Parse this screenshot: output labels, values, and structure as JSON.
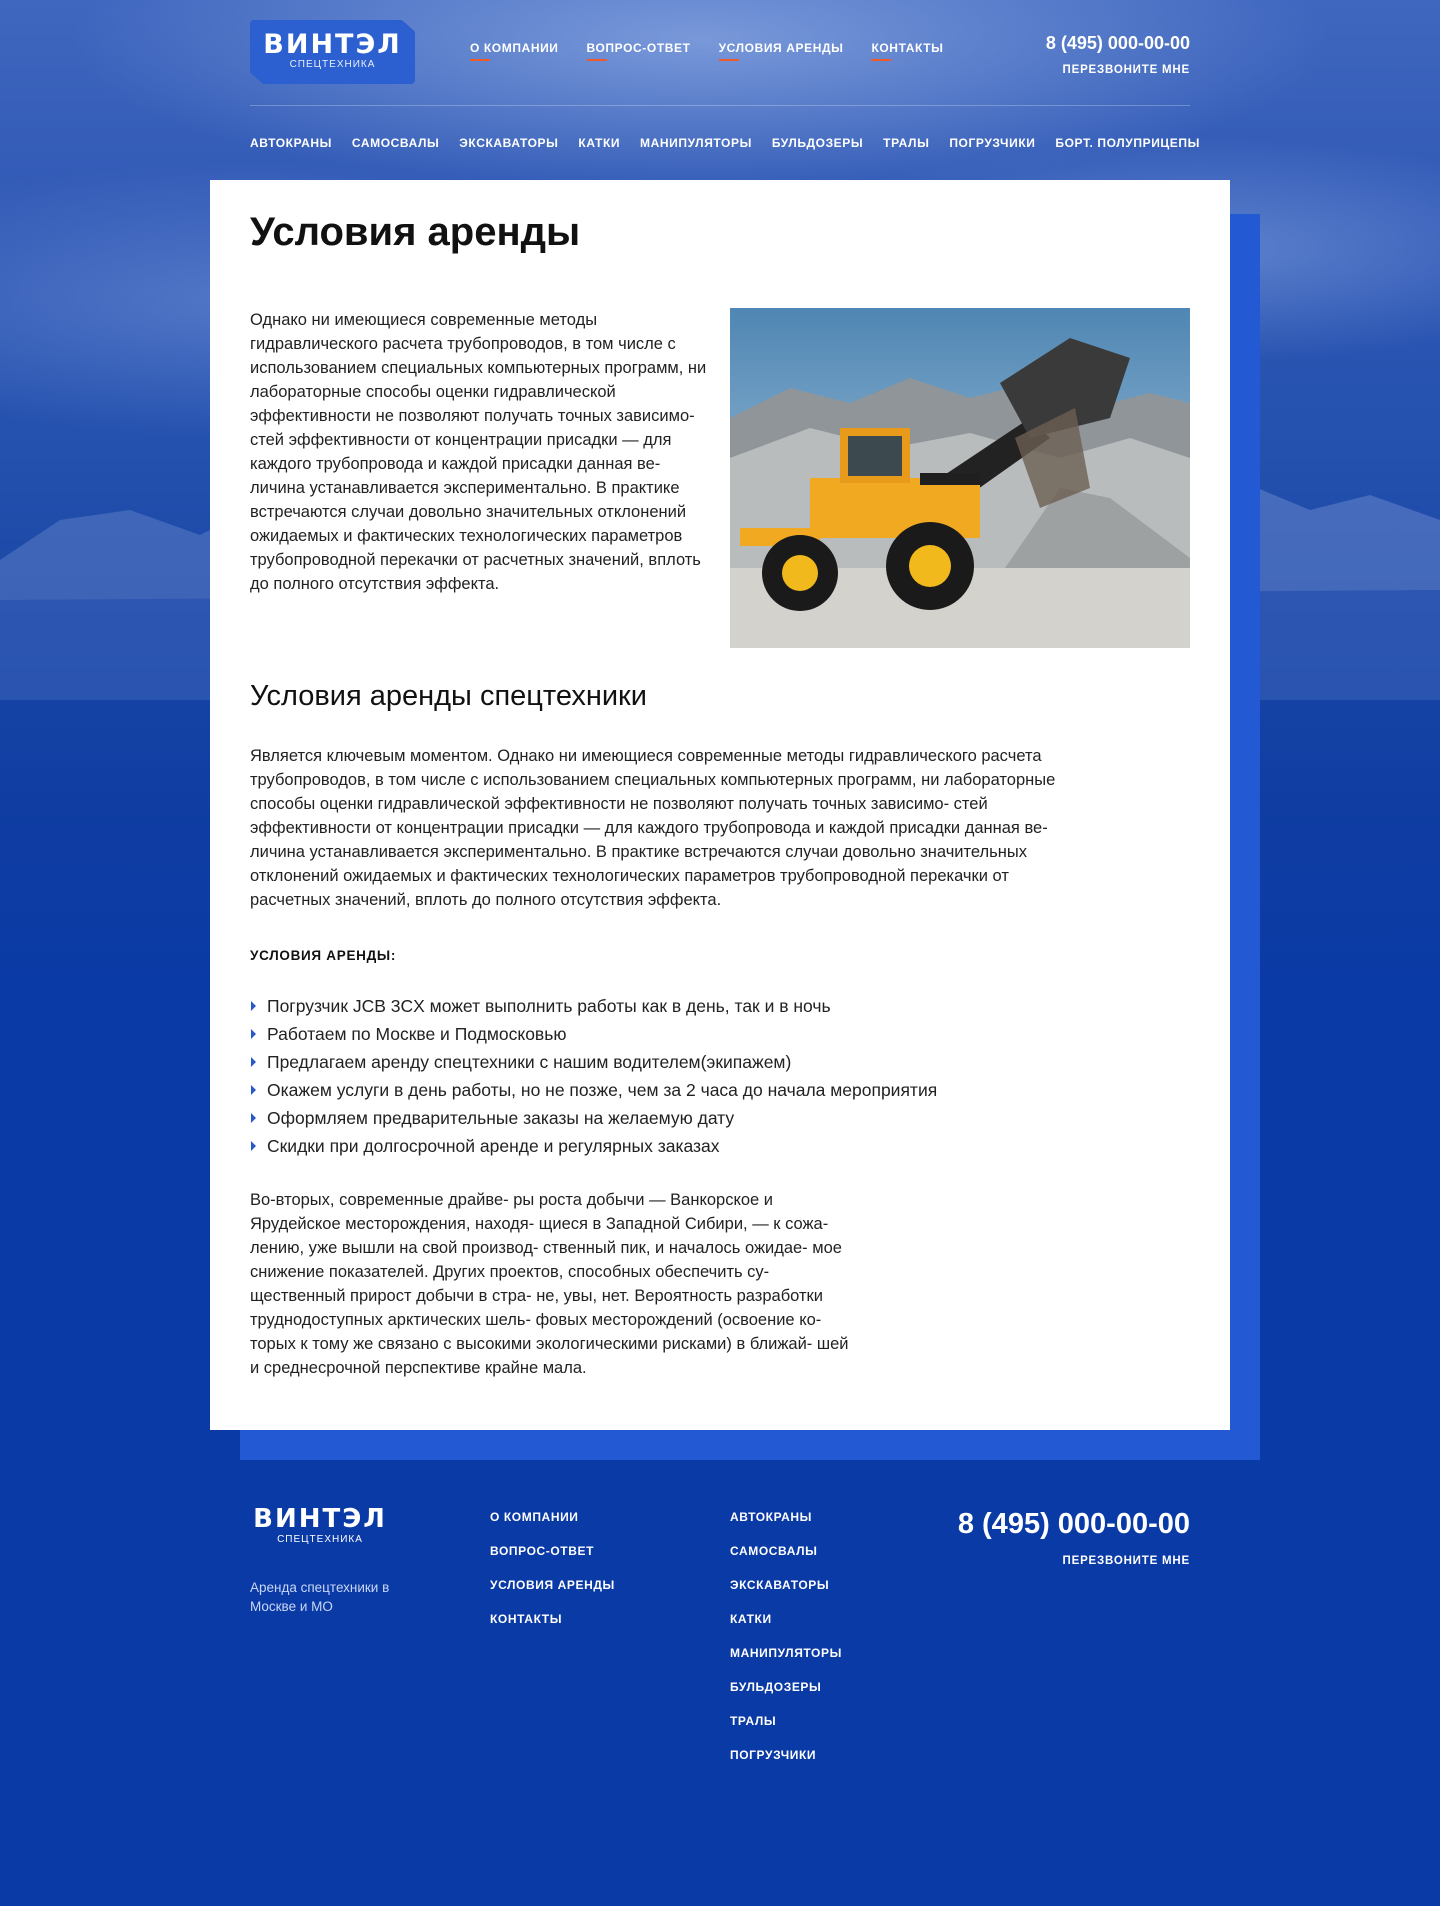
{
  "brand": {
    "name": "ВИНТЭЛ",
    "subtitle": "СПЕЦТЕХНИКА"
  },
  "header": {
    "nav": [
      "О компании",
      "Вопрос-ответ",
      "Условия аренды",
      "Контакты"
    ],
    "phone": "8 (495) 000-00-00",
    "callback": "Перезвоните мне"
  },
  "categories": [
    "Автокраны",
    "Самосвалы",
    "Экскаваторы",
    "Катки",
    "Манипуляторы",
    "Бульдозеры",
    "Тралы",
    "Погрузчики",
    "Борт. полуприцепы"
  ],
  "main": {
    "title": "Условия аренды",
    "intro": "Однако ни имеющиеся современные методы гидравлического расчета трубопроводов, в том числе с использованием специальных компьютерных программ, ни лабораторные способы оценки гидравлической эффективности не позволяют получать точных зависимо- стей эффективности от концентрации присадки — для каждого трубопровода и каждой присадки данная ве- личина устанавливается экспериментально. В практике встречаются случаи довольно значительных отклонений ожидаемых и фактических технологических параметров трубопроводной перекачки от расчетных значений, вплоть до полного отсутствия эффекта.",
    "photo_icon": "jcb-wheel-loader-image",
    "subtitle": "Условия аренды спецтехники",
    "para2": "Является ключевым моментом. Однако ни имеющиеся современные методы гидравлического расчета трубопроводов, в том числе с использованием специальных компьютерных программ, ни лабораторные способы оценки гидравлической эффективности не позволяют получать точных зависимо- стей эффективности от концентрации присадки — для каждого трубопровода и каждой присадки данная ве- личина устанавливается экспериментально. В практике встречаются случаи довольно значительных отклонений ожидаемых и фактических технологических параметров трубопроводной перекачки от расчетных значений, вплоть до полного отсутствия эффекта.",
    "terms_heading": "УСЛОВИЯ АРЕНДЫ:",
    "terms": [
      "Погрузчик JCB 3CX может выполнить работы как в день, так и в ночь",
      "Работаем по Москве и Подмосковью",
      "Предлагаем аренду спецтехники с нашим водителем(экипажем)",
      "Окажем услуги в день работы, но не позже, чем за 2 часа до начала мероприятия",
      "Оформляем предварительные заказы на желаемую дату",
      "Скидки при долгосрочной аренде и регулярных заказах"
    ],
    "para3": "Во-вторых, современные драйве- ры роста добычи — Ванкорское и Ярудейское месторождения, находя- щиеся в Западной Сибири, — к сожа- лению, уже вышли на свой производ- ственный пик, и началось ожидае- мое снижение показателей. Других проектов, способных обеспечить су- щественный прирост добычи в стра- не, увы, нет. Вероятность разработки труднодоступных арктических шель- фовых месторождений (освоение ко- торых к тому же связано с высокими экологическими рисками) в ближай- шей и среднесрочной перспективе крайне мала."
  },
  "footer": {
    "tagline": "Аренда спецтехники в Москве и МО",
    "nav": [
      "О компании",
      "Вопрос-ответ",
      "Условия аренды",
      "Контакты"
    ],
    "categories": [
      "Автокраны",
      "Самосвалы",
      "Экскаваторы",
      "Катки",
      "Манипуляторы",
      "Бульдозеры",
      "Тралы",
      "Погрузчики"
    ],
    "phone": "8 (495) 000-00-00",
    "callback": "Перезвоните мне"
  },
  "colors": {
    "background": "#0a3aa6",
    "accent": "#f05a28",
    "card_shadow": "#2459d4",
    "logo_bg": "#2c5fd0"
  }
}
